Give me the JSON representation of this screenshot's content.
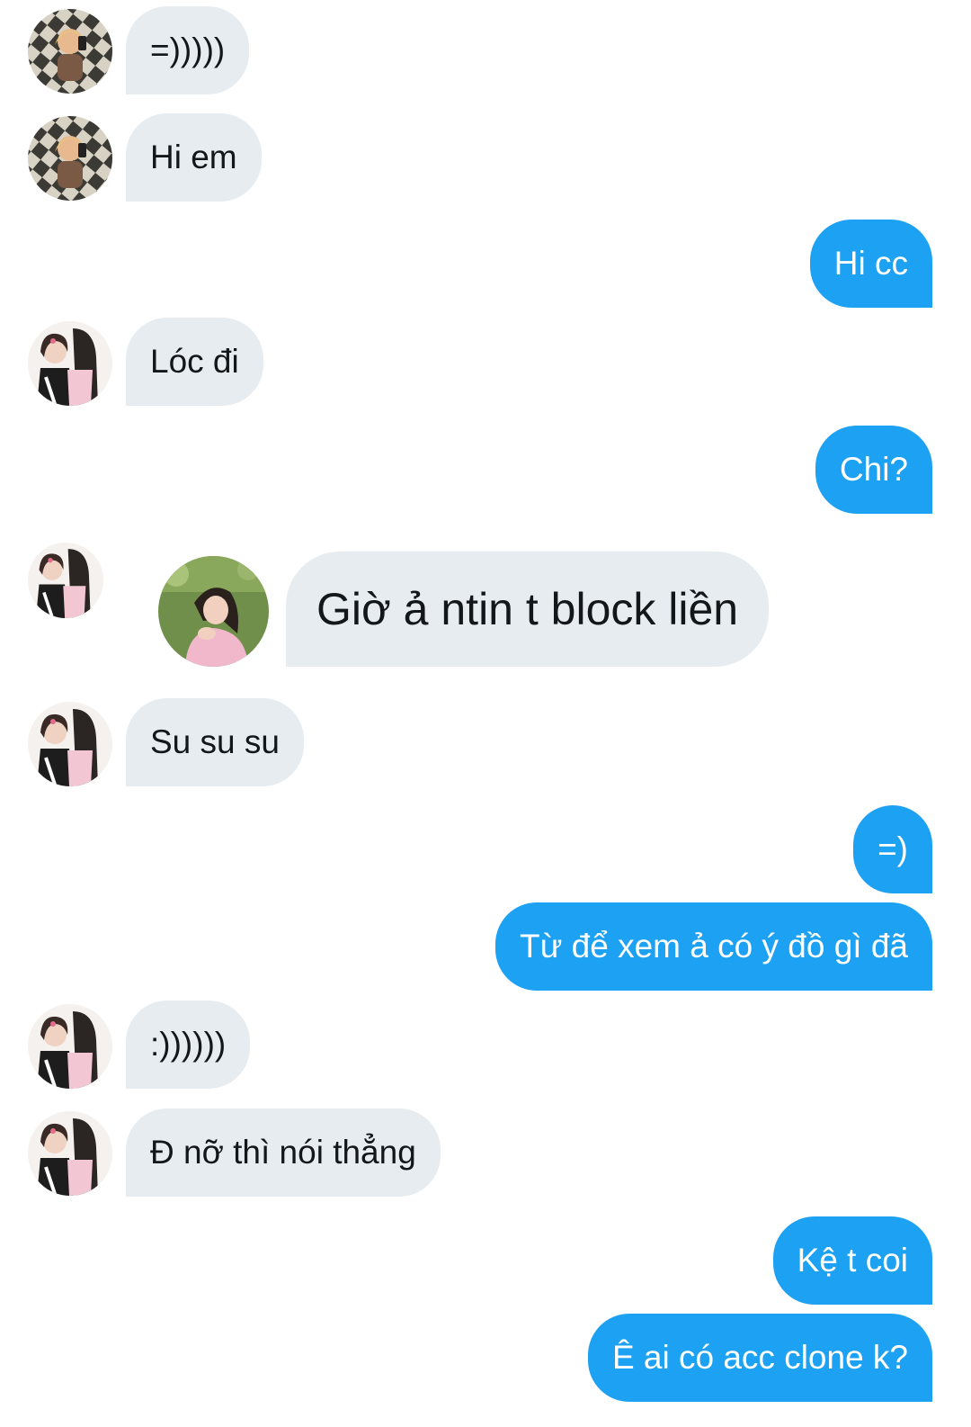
{
  "conversation": {
    "messages": [
      {
        "sender": "other",
        "avatar": "avatar-a-icon",
        "text": "=)))))"
      },
      {
        "sender": "other",
        "avatar": "avatar-a-icon",
        "text": "Hi em"
      },
      {
        "sender": "me",
        "text": "Hi cc"
      },
      {
        "sender": "other",
        "avatar": "avatar-b-icon",
        "text": "Lóc đi"
      },
      {
        "sender": "me",
        "text": "Chi?"
      },
      {
        "sender": "other",
        "avatar": "avatar-b-icon",
        "sticker": "girl-photo-sticker-icon",
        "text": "Giờ ả ntin t block liền"
      },
      {
        "sender": "other",
        "avatar": "avatar-b-icon",
        "text": "Su su su"
      },
      {
        "sender": "me",
        "text": "=)"
      },
      {
        "sender": "me",
        "text": "Từ để xem ả có ý đồ gì đã"
      },
      {
        "sender": "other",
        "avatar": "avatar-b-icon",
        "text": ":))))))"
      },
      {
        "sender": "other",
        "avatar": "avatar-b-icon",
        "text": "Đ nỡ thì nói thẳng"
      },
      {
        "sender": "me",
        "text": "Kệ t coi"
      },
      {
        "sender": "me",
        "text": "Ê ai có acc clone k?"
      }
    ]
  },
  "colors": {
    "incoming_bubble": "#e6ecf0",
    "outgoing_bubble": "#1da1f2",
    "incoming_text": "#14171a",
    "outgoing_text": "#ffffff"
  }
}
